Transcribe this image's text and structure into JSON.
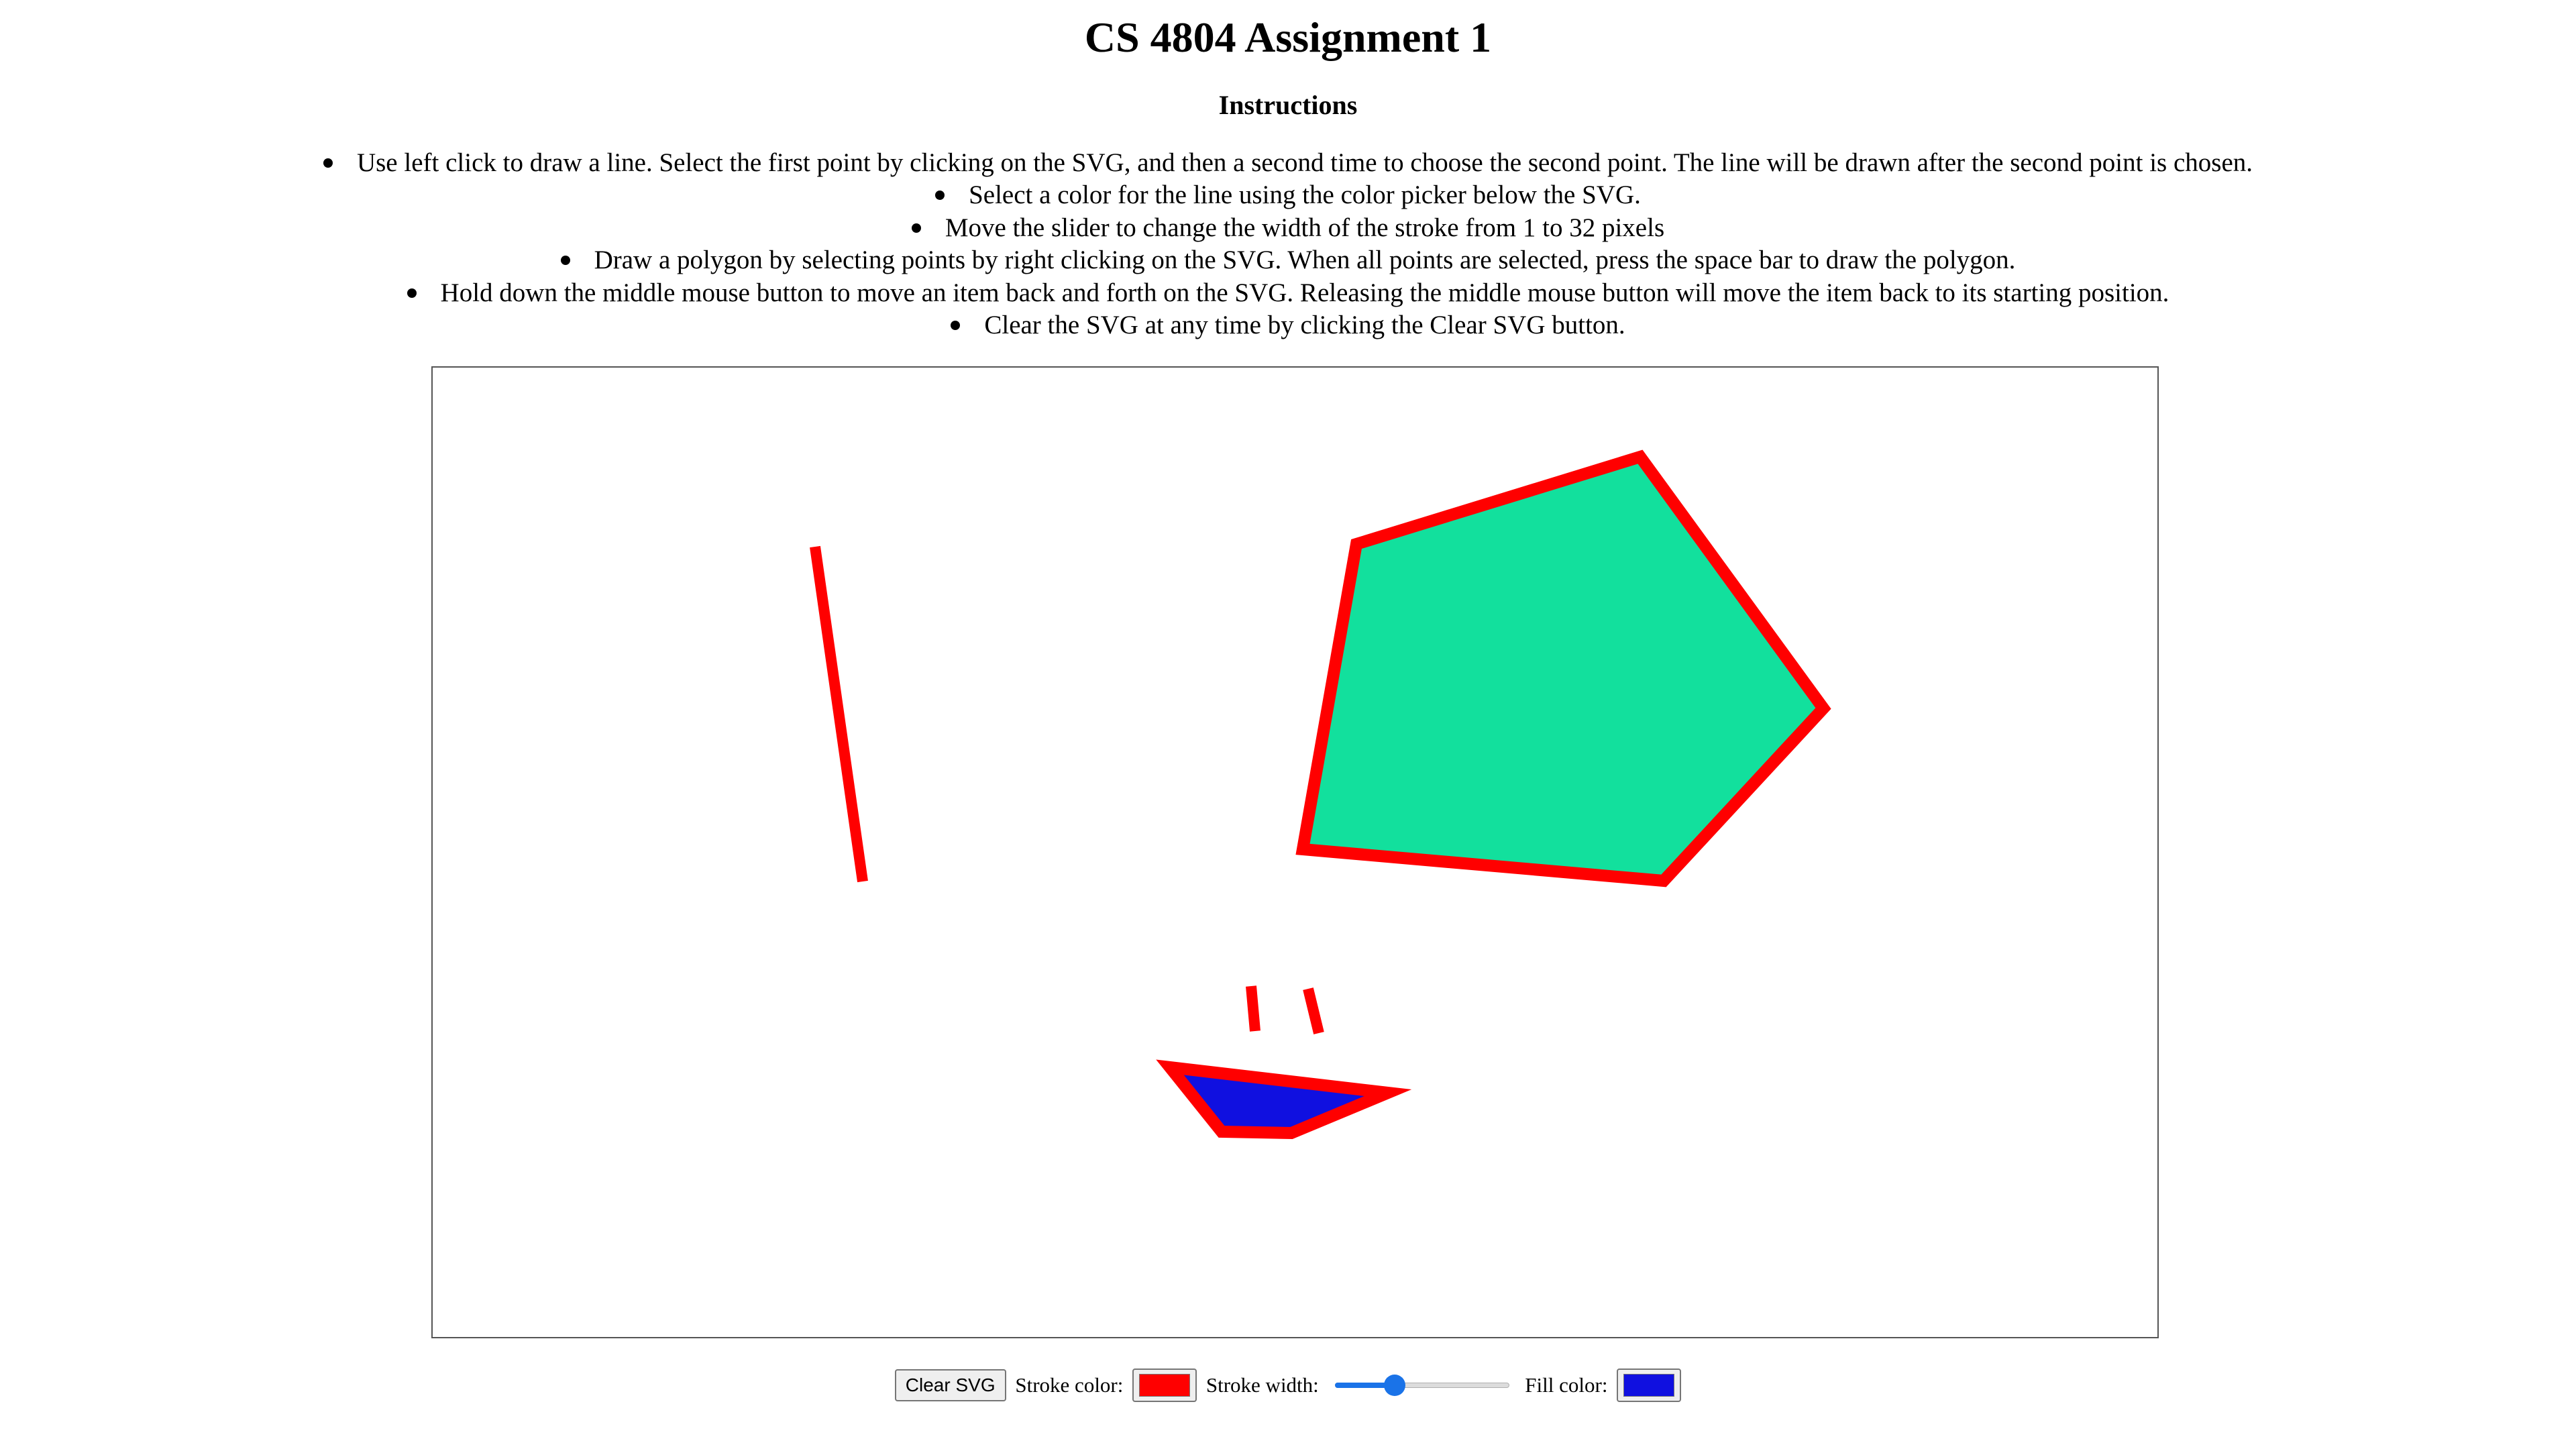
{
  "page": {
    "title": "CS 4804 Assignment 1",
    "instructions_heading": "Instructions"
  },
  "instructions": [
    "Use left click to draw a line. Select the first point by clicking on the SVG, and then a second time to choose the second point. The line will be drawn after the second point is chosen.",
    "Select a color for the line using the color picker below the SVG.",
    "Move the slider to change the width of the stroke from 1 to 32 pixels",
    "Draw a polygon by selecting points by right clicking on the SVG. When all points are selected, press the space bar to draw the polygon.",
    "Hold down the middle mouse button to move an item back and forth on the SVG. Releasing the middle mouse button will move the item back to its starting position.",
    "Clear the SVG at any time by clicking the Clear SVG button."
  ],
  "controls": {
    "clear_button_label": "Clear SVG",
    "stroke_color_label": "Stroke color:",
    "stroke_color": "#ff0000",
    "stroke_width_label": "Stroke width:",
    "stroke_width": {
      "min": 1,
      "max": 32,
      "value": 11
    },
    "fill_color_label": "Fill color:",
    "fill_color": "#1010e0"
  },
  "drawing": {
    "polygon_fill_green": "#12e09d",
    "polygon_fill_blue": "#1010e0",
    "stroke_red": "#ff0000"
  }
}
